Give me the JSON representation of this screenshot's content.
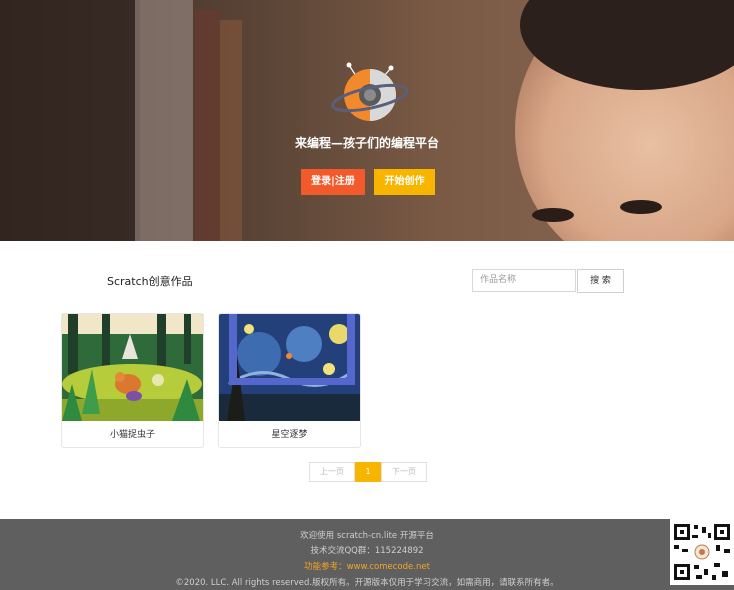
{
  "hero": {
    "title": "来编程—孩子们的编程平台",
    "login_button": "登录|注册",
    "create_button": "开始创作"
  },
  "section": {
    "title": "Scratch创意作品",
    "search_placeholder": "作品名称",
    "search_button": "搜 索"
  },
  "projects": [
    {
      "title": "小猫捉虫子"
    },
    {
      "title": "星空逐梦"
    }
  ],
  "pagination": {
    "prev": "上一页",
    "current": "1",
    "next": "下一页"
  },
  "footer": {
    "line1": "欢迎使用 scratch-cn.lite 开源平台",
    "line2": "技术交流QQ群：115224892",
    "line3": "功能参考：www.comecode.net",
    "line4": "©2020. LLC. All rights reserved.版权所有。开源版本仅用于学习交流，如需商用，请联系所有者。"
  },
  "colors": {
    "accent_orange": "#f25a2b",
    "accent_yellow": "#f7b500",
    "footer_bg": "#5f5f5f"
  },
  "icons": [
    "planet-logo-icon",
    "qr-code-icon"
  ]
}
